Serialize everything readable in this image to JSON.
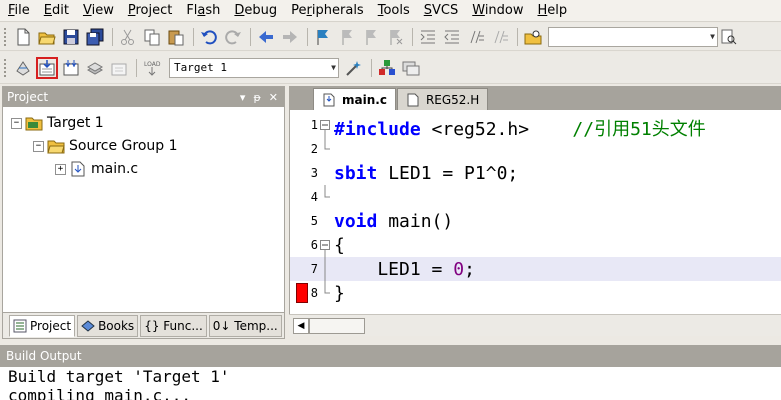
{
  "menu": {
    "items": [
      {
        "pre": "",
        "acc": "F",
        "post": "ile"
      },
      {
        "pre": "",
        "acc": "E",
        "post": "dit"
      },
      {
        "pre": "",
        "acc": "V",
        "post": "iew"
      },
      {
        "pre": "",
        "acc": "P",
        "post": "roject"
      },
      {
        "pre": "Fl",
        "acc": "a",
        "post": "sh"
      },
      {
        "pre": "",
        "acc": "D",
        "post": "ebug"
      },
      {
        "pre": "Pe",
        "acc": "r",
        "post": "ipherals"
      },
      {
        "pre": "",
        "acc": "T",
        "post": "ools"
      },
      {
        "pre": "",
        "acc": "S",
        "post": "VCS"
      },
      {
        "pre": "",
        "acc": "W",
        "post": "indow"
      },
      {
        "pre": "",
        "acc": "H",
        "post": "elp"
      }
    ]
  },
  "toolbar2": {
    "target_select": "Target 1"
  },
  "project_panel": {
    "title": "Project",
    "controls": [
      "▾",
      "ᵽ",
      "✕"
    ],
    "tree": {
      "root": "Target 1",
      "group": "Source Group 1",
      "file": "main.c"
    },
    "tabs": [
      "Project",
      "Books",
      "{} Func...",
      "0↓ Temp..."
    ]
  },
  "editor": {
    "tabs": [
      "main.c",
      "REG52.H"
    ],
    "lines": [
      {
        "n": "1"
      },
      {
        "n": "2"
      },
      {
        "n": "3"
      },
      {
        "n": "4"
      },
      {
        "n": "5"
      },
      {
        "n": "6"
      },
      {
        "n": "7"
      },
      {
        "n": "8"
      }
    ],
    "code": {
      "l1_kw": "#include",
      "l1_rest": " <reg52.h>    ",
      "l1_cmt": "//引用51头文件",
      "l3_kw": "sbit",
      "l3_rest": " LED1 = P1^0;",
      "l5_kw": "void",
      "l5_rest": " main()",
      "l6": "{",
      "l7_a": "    LED1 = ",
      "l7_num": "0",
      "l7_b": ";",
      "l8": "}"
    },
    "current_line": 7,
    "breakpoint_line": 8
  },
  "build_output": {
    "title": "Build Output",
    "lines": [
      "Build target 'Target 1'",
      "compiling main.c..."
    ]
  },
  "colors": {
    "keyword": "#0000ff",
    "comment": "#008000",
    "number": "#800080",
    "breakpoint": "#ff0000",
    "highlight_box": "#d62020"
  }
}
